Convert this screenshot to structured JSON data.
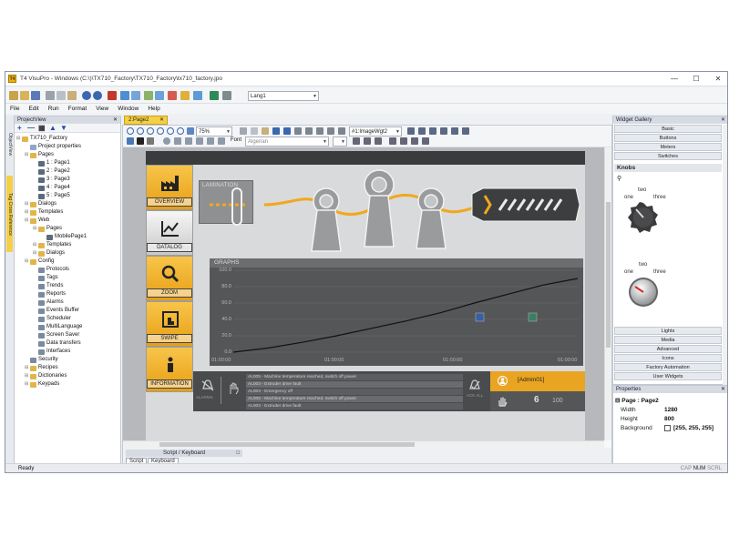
{
  "window": {
    "title": "T4 VisuPro - Windows (C:\\)\\TX710_Factory\\TX710_Factory\\tx710_factory.jpo",
    "language_combo": "Lang1"
  },
  "menu": [
    "File",
    "Edit",
    "Run",
    "Format",
    "View",
    "Window",
    "Help"
  ],
  "dock_tabs": [
    "ObjectView",
    "Tag Cross Reference"
  ],
  "project_view": {
    "title": "ProjectView",
    "tree": [
      {
        "label": "TX710_Factory",
        "level": 0,
        "icon": "folder"
      },
      {
        "label": "Project properties",
        "level": 1,
        "icon": "doc"
      },
      {
        "label": "Pages",
        "level": 1,
        "icon": "folder"
      },
      {
        "label": "1 : Page1",
        "level": 2,
        "icon": "page"
      },
      {
        "label": "2 : Page2",
        "level": 2,
        "icon": "page"
      },
      {
        "label": "3 : Page3",
        "level": 2,
        "icon": "page"
      },
      {
        "label": "4 : Page4",
        "level": 2,
        "icon": "page"
      },
      {
        "label": "5 : Page5",
        "level": 2,
        "icon": "page"
      },
      {
        "label": "Dialogs",
        "level": 1,
        "icon": "folder"
      },
      {
        "label": "Templates",
        "level": 1,
        "icon": "folder"
      },
      {
        "label": "Web",
        "level": 1,
        "icon": "folder"
      },
      {
        "label": "Pages",
        "level": 2,
        "icon": "folder"
      },
      {
        "label": "MobilePage1",
        "level": 3,
        "icon": "page"
      },
      {
        "label": "Templates",
        "level": 2,
        "icon": "folder"
      },
      {
        "label": "Dialogs",
        "level": 2,
        "icon": "folder"
      },
      {
        "label": "Config",
        "level": 1,
        "icon": "folder"
      },
      {
        "label": "Protocols",
        "level": 2,
        "icon": "gear"
      },
      {
        "label": "Tags",
        "level": 2,
        "icon": "gear"
      },
      {
        "label": "Trends",
        "level": 2,
        "icon": "gear"
      },
      {
        "label": "Reports",
        "level": 2,
        "icon": "gear"
      },
      {
        "label": "Alarms",
        "level": 2,
        "icon": "gear"
      },
      {
        "label": "Events Buffer",
        "level": 2,
        "icon": "gear"
      },
      {
        "label": "Scheduler",
        "level": 2,
        "icon": "gear"
      },
      {
        "label": "MultiLanguage",
        "level": 2,
        "icon": "gear"
      },
      {
        "label": "Screen Saver",
        "level": 2,
        "icon": "gear"
      },
      {
        "label": "Data transfers",
        "level": 2,
        "icon": "gear"
      },
      {
        "label": "Interfaces",
        "level": 2,
        "icon": "gear"
      },
      {
        "label": "Security",
        "level": 1,
        "icon": "gear"
      },
      {
        "label": "Recipes",
        "level": 1,
        "icon": "folder"
      },
      {
        "label": "Dictionaries",
        "level": 1,
        "icon": "folder"
      },
      {
        "label": "Keypads",
        "level": 1,
        "icon": "folder"
      }
    ]
  },
  "editor": {
    "tab": "2:Page2",
    "zoom": "75%",
    "font_label": "Font",
    "font_combo": "Algerian",
    "widget_combo": "#1:ImageWgt2"
  },
  "hmi": {
    "nav": [
      "OVERVIEW",
      "DATALOG",
      "ZOOM",
      "SWIPE",
      "INFORMATION"
    ],
    "lamination": "LAMINATION",
    "graphs_title": "GRAPHS",
    "y_ticks": [
      "100.0",
      "80.0",
      "60.0",
      "40.0",
      "20.0",
      "0.0"
    ],
    "x_ticks": [
      "01:00:00",
      "01:00:00",
      "01:00:00",
      "01:00:00"
    ],
    "curve_progress": [
      0.0,
      0.05,
      0.12,
      0.2,
      0.29,
      0.38,
      0.48,
      0.6,
      0.71,
      0.82,
      0.9
    ],
    "alarms_label": "ALARMS",
    "ack_label": "ACK ALL",
    "alarms": [
      "AL005 - Machine temperature reached, switch off power",
      "AL003 - Extruder drive fault",
      "AL004 - Emergency off",
      "AL005 - Machine temperature reached, switch off power",
      "AL003 - Extruder drive fault"
    ],
    "user": "[Admin01]",
    "level": "6",
    "level_value": "100"
  },
  "bottom_pane": {
    "title": "Script / Keyboard",
    "tabs": [
      "Script",
      "Keyboard"
    ]
  },
  "widget_gallery": {
    "title": "Widget Gallery",
    "top_categories": [
      "Basic",
      "Buttons",
      "Meters",
      "Switches"
    ],
    "section": "Knobs",
    "knob_labels": [
      "one",
      "two",
      "three"
    ],
    "bottom_categories": [
      "Lights",
      "Media",
      "Advanced",
      "Icons",
      "Factory Automation",
      "User Widgets"
    ]
  },
  "properties": {
    "title": "Properties",
    "page": "Page : Page2",
    "width_label": "Width",
    "width": "1280",
    "height_label": "Height",
    "height": "800",
    "background_label": "Background",
    "background": "[255, 255, 255]"
  },
  "status": {
    "ready": "Ready",
    "caps": "CAP",
    "num": "NUM",
    "scrl": "SCRL"
  }
}
